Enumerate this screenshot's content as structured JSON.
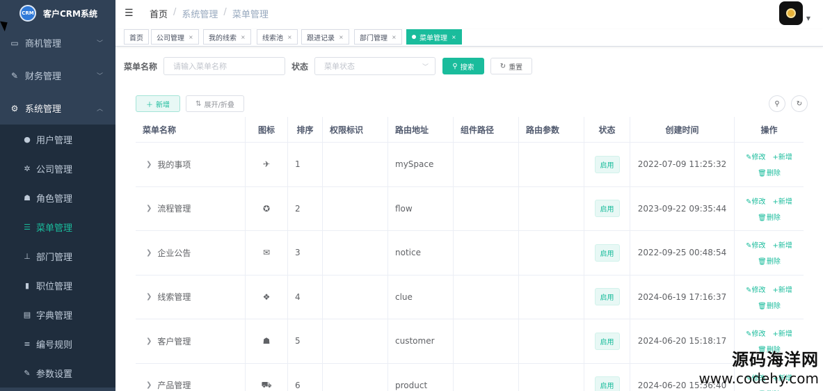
{
  "app": {
    "logo_badge": "CRM",
    "title": "客户CRM系统"
  },
  "sidebar": {
    "top_items": [
      {
        "label": "商机管理",
        "icon": "monitor-icon"
      },
      {
        "label": "财务管理",
        "icon": "edit-icon"
      },
      {
        "label": "系统管理",
        "icon": "gear-icon"
      }
    ],
    "sub_items": [
      {
        "label": "用户管理",
        "icon": "user-icon"
      },
      {
        "label": "公司管理",
        "icon": "bug-icon"
      },
      {
        "label": "角色管理",
        "icon": "peoples-icon"
      },
      {
        "label": "菜单管理",
        "icon": "tree-table-icon"
      },
      {
        "label": "部门管理",
        "icon": "tree-icon"
      },
      {
        "label": "职位管理",
        "icon": "post-icon"
      },
      {
        "label": "字典管理",
        "icon": "dict-icon"
      },
      {
        "label": "编号规则",
        "icon": "list-icon"
      },
      {
        "label": "参数设置",
        "icon": "edit-icon"
      }
    ]
  },
  "header": {
    "breadcrumb": [
      "首页",
      "系统管理",
      "菜单管理"
    ],
    "sep": "/"
  },
  "tags": [
    {
      "label": "首页",
      "closable": false
    },
    {
      "label": "公司管理",
      "closable": true
    },
    {
      "label": "我的线索",
      "closable": true
    },
    {
      "label": "线索池",
      "closable": true
    },
    {
      "label": "跟进记录",
      "closable": true
    },
    {
      "label": "部门管理",
      "closable": true
    },
    {
      "label": "菜单管理",
      "closable": true,
      "active": true
    }
  ],
  "close_glyph": "×",
  "search": {
    "name_label": "菜单名称",
    "name_placeholder": "请输入菜单名称",
    "status_label": "状态",
    "status_placeholder": "菜单状态",
    "search_btn": "搜索",
    "reset_btn": "重置"
  },
  "toolbar": {
    "add_btn": "新增",
    "expand_btn": "展开/折叠"
  },
  "table": {
    "columns": [
      "菜单名称",
      "图标",
      "排序",
      "权限标识",
      "路由地址",
      "组件路径",
      "路由参数",
      "状态",
      "创建时间",
      "操作"
    ],
    "rows": [
      {
        "name": "我的事项",
        "icon": "✈",
        "sort": "1",
        "perm": "",
        "route": "mySpace",
        "status": "启用",
        "time": "2022-07-09 11:25:32"
      },
      {
        "name": "流程管理",
        "icon": "✪",
        "sort": "2",
        "perm": "",
        "route": "flow",
        "status": "启用",
        "time": "2023-09-22 09:35:44"
      },
      {
        "name": "企业公告",
        "icon": "✉",
        "sort": "3",
        "perm": "",
        "route": "notice",
        "status": "启用",
        "time": "2022-09-25 00:48:54"
      },
      {
        "name": "线索管理",
        "icon": "❖",
        "sort": "4",
        "perm": "",
        "route": "clue",
        "status": "启用",
        "time": "2024-06-19 17:16:37"
      },
      {
        "name": "客户管理",
        "icon": "☗",
        "sort": "5",
        "perm": "",
        "route": "customer",
        "status": "启用",
        "time": "2024-06-20 15:18:17"
      },
      {
        "name": "产品管理",
        "icon": "⛟",
        "sort": "6",
        "perm": "",
        "route": "product",
        "status": "启用",
        "time": "2024-06-20 15:36:40"
      }
    ],
    "ops": {
      "edit": "修改",
      "add": "新增",
      "delete": "删除"
    }
  },
  "watermark": {
    "line1": "源码海洋网",
    "line2": "www.codehy.com"
  }
}
